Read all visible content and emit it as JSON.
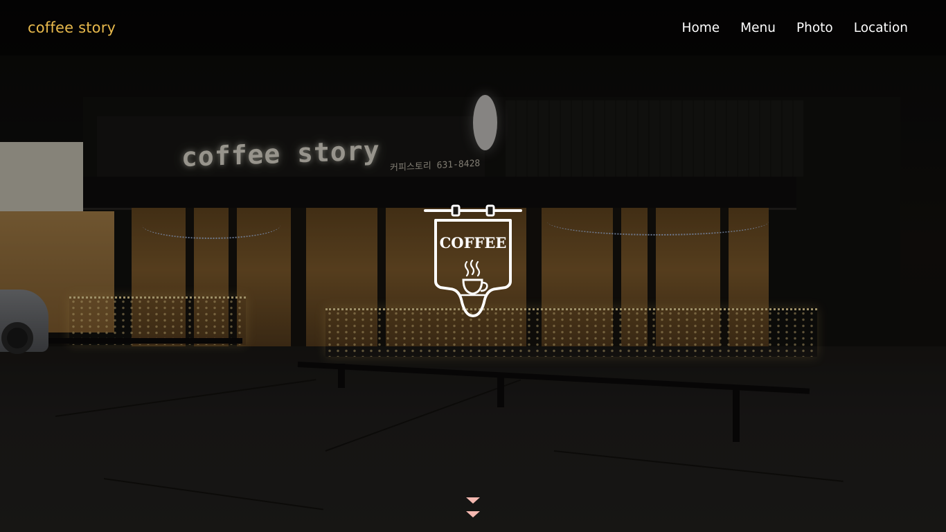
{
  "header": {
    "brand": "coffee story",
    "nav": [
      {
        "label": "Home"
      },
      {
        "label": "Menu"
      },
      {
        "label": "Photo"
      },
      {
        "label": "Location"
      }
    ]
  },
  "hero": {
    "background_image": "night storefront of coffee story cafe",
    "storefront_sign": "coffee story",
    "storefront_phone": "커피스토리 631-8428",
    "emblem": {
      "icon": "coffee-signboard-icon",
      "label": "COFFEE"
    },
    "scroll_indicator": {
      "icon": "double-chevron-down-icon"
    }
  },
  "colors": {
    "brand": "#e8b94c",
    "nav_text": "#ffffff",
    "header_bg": "#000000",
    "emblem": "#ffffff",
    "scroll_arrows": "#f4b8b0"
  }
}
